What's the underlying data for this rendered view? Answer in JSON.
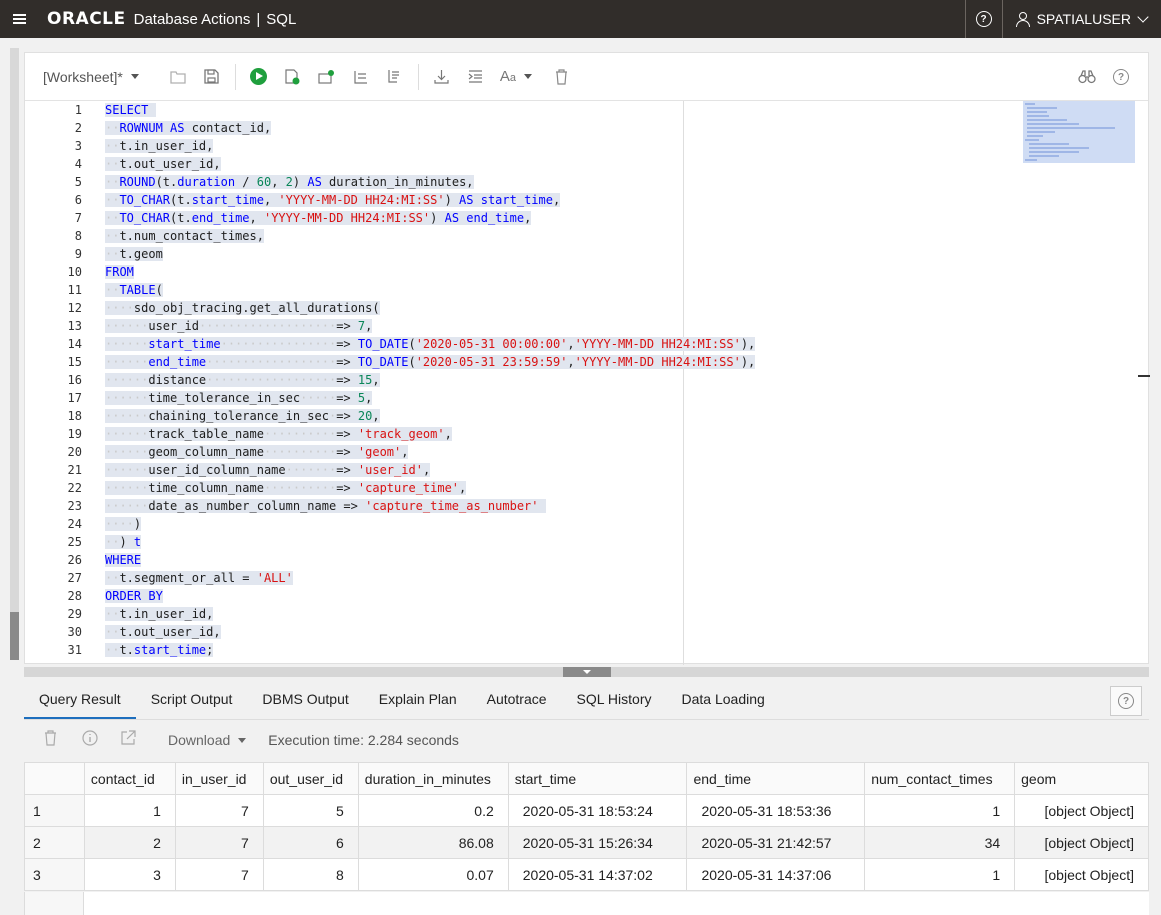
{
  "header": {
    "logo": "ORACLE",
    "app": "Database Actions",
    "separator": "|",
    "section": "SQL",
    "help": "?",
    "user": "SPATIALUSER"
  },
  "toolbar": {
    "worksheet_name": "[Worksheet]*"
  },
  "editor": {
    "line_numbers": [
      "1",
      "2",
      "3",
      "4",
      "5",
      "6",
      "7",
      "8",
      "9",
      "10",
      "11",
      "12",
      "13",
      "14",
      "15",
      "16",
      "17",
      "18",
      "19",
      "20",
      "21",
      "22",
      "23",
      "24",
      "25",
      "26",
      "27",
      "28",
      "29",
      "30",
      "31"
    ]
  },
  "results": {
    "tabs": [
      "Query Result",
      "Script Output",
      "DBMS Output",
      "Explain Plan",
      "Autotrace",
      "SQL History",
      "Data Loading"
    ],
    "download_label": "Download",
    "execution_time": "Execution time: 2.284 seconds",
    "columns": [
      "contact_id",
      "in_user_id",
      "out_user_id",
      "duration_in_minutes",
      "start_time",
      "end_time",
      "num_contact_times",
      "geom"
    ],
    "rows": [
      [
        "1",
        "1",
        "7",
        "5",
        "0.2",
        "2020-05-31 18:53:24",
        "2020-05-31 18:53:36",
        "1",
        "[object Object]"
      ],
      [
        "2",
        "2",
        "7",
        "6",
        "86.08",
        "2020-05-31 15:26:34",
        "2020-05-31 21:42:57",
        "34",
        "[object Object]"
      ],
      [
        "3",
        "3",
        "7",
        "8",
        "0.07",
        "2020-05-31 14:37:02",
        "2020-05-31 14:37:06",
        "1",
        "[object Object]"
      ]
    ]
  },
  "colors": {
    "header_bg": "#312d2a",
    "keyword": "#0000ff",
    "string": "#d91212",
    "number": "#098658",
    "run_green": "#1f9f3d",
    "active_tab": "#1d6ebd"
  }
}
